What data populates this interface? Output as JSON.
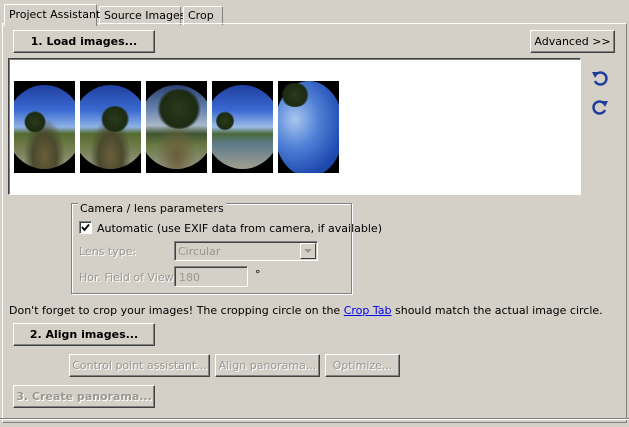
{
  "tabs": [
    {
      "label": "Project Assistant",
      "active": true
    },
    {
      "label": "Source Images",
      "active": false
    },
    {
      "label": "Crop",
      "active": false
    }
  ],
  "buttons": {
    "load_images": "1. Load images...",
    "advanced": "Advanced >>",
    "align_images": "2. Align images...",
    "control_point_assistant": "Control point assistant...",
    "align_panorama": "Align panorama...",
    "optimize": "Optimize...",
    "create_panorama": "3. Create panorama..."
  },
  "preview": {
    "thumbnail_count": 5,
    "rotate_left_icon": "rotate-ccw-icon",
    "rotate_right_icon": "rotate-cw-icon"
  },
  "camera": {
    "group_title": "Camera / lens parameters",
    "automatic_label": "Automatic (use EXIF data from camera, if available)",
    "automatic_checked": true,
    "lens_type_label": "Lens type:",
    "lens_type_value": "Circular",
    "hfov_label": "Hor. Field of View:",
    "hfov_value": "180",
    "hfov_unit": "°"
  },
  "crop_hint": {
    "before": "Don't forget to crop your images! The cropping circle on the ",
    "link": "Crop Tab",
    "after": " should match the actual image circle."
  },
  "colors": {
    "window_bg": "#d4d0c8",
    "link": "#0000ee",
    "icon_blue": "#1e3c9c"
  }
}
